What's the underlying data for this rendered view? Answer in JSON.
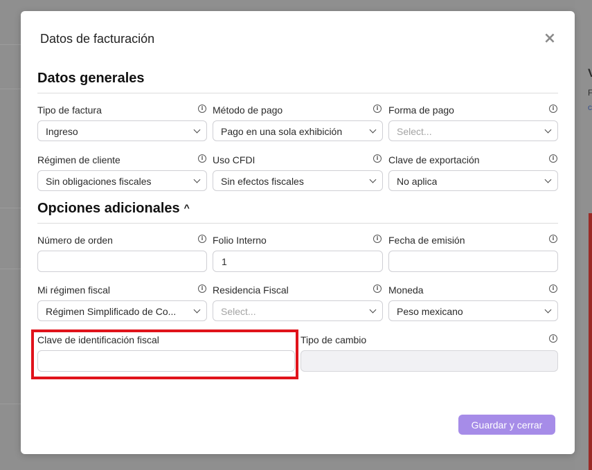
{
  "modal": {
    "title": "Datos de facturación",
    "close_icon": "close-icon"
  },
  "background": {
    "right_heading": "V",
    "right_text_1": "F",
    "right_text_2": "c"
  },
  "sections": {
    "general": "Datos generales",
    "additional": "Opciones adicionales"
  },
  "fields": {
    "tipo_factura": {
      "label": "Tipo de factura",
      "value": "Ingreso"
    },
    "metodo_pago": {
      "label": "Método de pago",
      "value": "Pago en una sola exhibición"
    },
    "forma_pago": {
      "label": "Forma de pago",
      "placeholder": "Select..."
    },
    "regimen_cliente": {
      "label": "Régimen de cliente",
      "value": "Sin obligaciones fiscales"
    },
    "uso_cfdi": {
      "label": "Uso CFDI",
      "value": "Sin efectos fiscales"
    },
    "clave_exportacion": {
      "label": "Clave de exportación",
      "value": "No aplica"
    },
    "numero_orden": {
      "label": "Número de orden",
      "value": ""
    },
    "folio_interno": {
      "label": "Folio Interno",
      "value": "1"
    },
    "fecha_emision": {
      "label": "Fecha de emisión",
      "value": ""
    },
    "mi_regimen": {
      "label": "Mi régimen fiscal",
      "value": "Régimen Simplificado de Co..."
    },
    "residencia_fiscal": {
      "label": "Residencia Fiscal",
      "placeholder": "Select..."
    },
    "moneda": {
      "label": "Moneda",
      "value": "Peso mexicano"
    },
    "clave_identificacion": {
      "label": "Clave de identificación fiscal",
      "value": ""
    },
    "tipo_cambio": {
      "label": "Tipo de cambio",
      "value": ""
    }
  },
  "footer": {
    "save_label": "Guardar y cerrar"
  },
  "colors": {
    "accent": "#a68ce8",
    "highlight": "#e0131b"
  }
}
